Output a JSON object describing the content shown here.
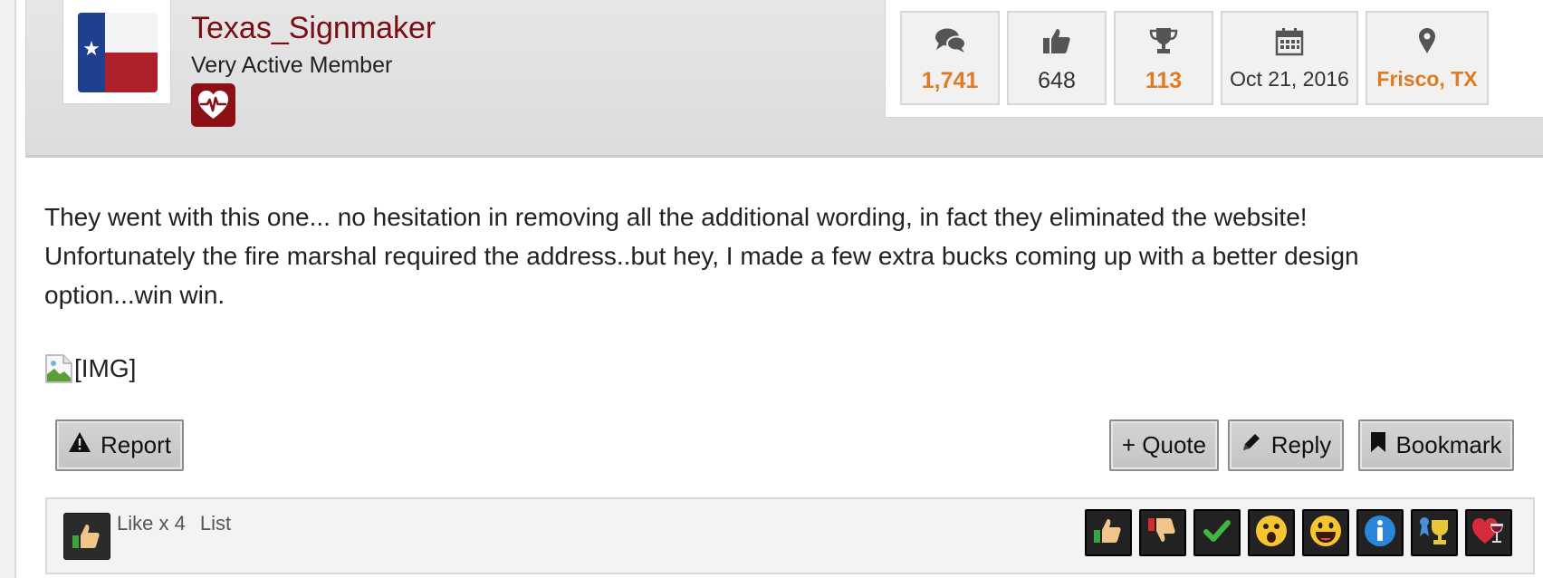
{
  "user": {
    "name": "Texas_Signmaker",
    "title": "Very Active Member",
    "avatar": "texas-flag-avatar",
    "badge": "heartbeat-badge"
  },
  "stats": {
    "messages": "1,741",
    "likes": "648",
    "trophy_points": "113",
    "joined": "Oct 21, 2016",
    "location": "Frisco, TX",
    "icons": [
      "speech-bubbles-icon",
      "thumbs-up-icon",
      "trophy-icon",
      "calendar-icon",
      "map-pin-icon"
    ]
  },
  "post": {
    "lines": [
      "They went with this one... no hesitation in removing all the additional wording, in fact they eliminated the website!",
      "Unfortunately the fire marshal required the address..but hey, I made a few extra bucks coming up with a better design",
      "option...win win."
    ],
    "image_alt": "[IMG]"
  },
  "actions": {
    "report": "Report",
    "quote": "+ Quote",
    "reply": "Reply",
    "bookmark": "Bookmark"
  },
  "likes_bar": {
    "summary": "Like x 4",
    "list": "List",
    "reactions": [
      "like",
      "dislike",
      "agree",
      "wow",
      "funny",
      "informative",
      "winner",
      "love"
    ]
  },
  "colors": {
    "username": "#7a0c12",
    "stat_highlight": "#e07a23",
    "badge": "#8b1116"
  }
}
